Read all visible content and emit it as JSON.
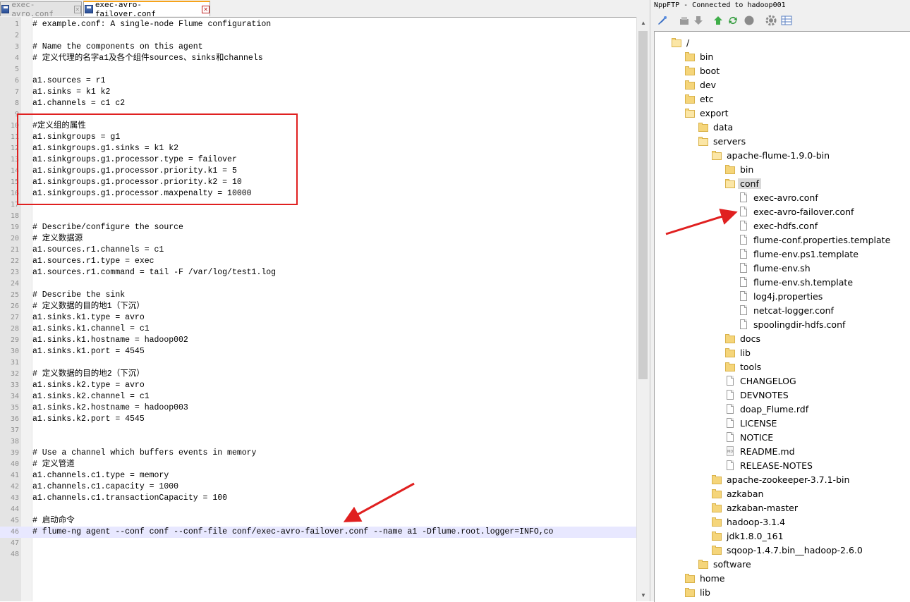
{
  "tabs": [
    {
      "label": "exec-avro.conf",
      "active": false
    },
    {
      "label": "exec-avro-failover.conf",
      "active": true
    }
  ],
  "editor": {
    "lines": [
      "# example.conf: A single-node Flume configuration",
      "",
      "# Name the components on this agent",
      "# 定义代理的名字a1及各个组件sources、sinks和channels",
      "",
      "a1.sources = r1",
      "a1.sinks = k1 k2",
      "a1.channels = c1 c2",
      "",
      "#定义组的属性",
      "a1.sinkgroups = g1",
      "a1.sinkgroups.g1.sinks = k1 k2",
      "a1.sinkgroups.g1.processor.type = failover",
      "a1.sinkgroups.g1.processor.priority.k1 = 5",
      "a1.sinkgroups.g1.processor.priority.k2 = 10",
      "a1.sinkgroups.g1.processor.maxpenalty = 10000",
      "",
      "",
      "# Describe/configure the source",
      "# 定义数据源",
      "a1.sources.r1.channels = c1",
      "a1.sources.r1.type = exec",
      "a1.sources.r1.command = tail -F /var/log/test1.log",
      "",
      "# Describe the sink",
      "# 定义数据的目的地1（下沉）",
      "a1.sinks.k1.type = avro",
      "a1.sinks.k1.channel = c1",
      "a1.sinks.k1.hostname = hadoop002",
      "a1.sinks.k1.port = 4545",
      "",
      "# 定义数据的目的地2（下沉）",
      "a1.sinks.k2.type = avro",
      "a1.sinks.k2.channel = c1",
      "a1.sinks.k2.hostname = hadoop003",
      "a1.sinks.k2.port = 4545",
      "",
      "",
      "# Use a channel which buffers events in memory",
      "# 定义管道",
      "a1.channels.c1.type = memory",
      "a1.channels.c1.capacity = 1000",
      "a1.channels.c1.transactionCapacity = 100",
      "",
      "# 启动命令",
      "# flume-ng agent --conf conf --conf-file conf/exec-avro-failover.conf --name a1 -Dflume.root.logger=INFO,co",
      "",
      ""
    ],
    "highlighted_line": 46
  },
  "ftp": {
    "title": "NppFTP - Connected to hadoop001",
    "toolbar_icons": [
      "connect-icon",
      "disconnect-icon",
      "download-icon",
      "upload-icon",
      "refresh-icon",
      "abort-icon",
      "settings-icon",
      "queue-icon"
    ],
    "tree": [
      {
        "label": "/",
        "depth": 0,
        "type": "folder",
        "open": true
      },
      {
        "label": "bin",
        "depth": 1,
        "type": "folder"
      },
      {
        "label": "boot",
        "depth": 1,
        "type": "folder"
      },
      {
        "label": "dev",
        "depth": 1,
        "type": "folder"
      },
      {
        "label": "etc",
        "depth": 1,
        "type": "folder"
      },
      {
        "label": "export",
        "depth": 1,
        "type": "folder",
        "open": true
      },
      {
        "label": "data",
        "depth": 2,
        "type": "folder"
      },
      {
        "label": "servers",
        "depth": 2,
        "type": "folder",
        "open": true
      },
      {
        "label": "apache-flume-1.9.0-bin",
        "depth": 3,
        "type": "folder",
        "open": true
      },
      {
        "label": "bin",
        "depth": 4,
        "type": "folder"
      },
      {
        "label": "conf",
        "depth": 4,
        "type": "folder",
        "open": true,
        "selected": true
      },
      {
        "label": "exec-avro.conf",
        "depth": 5,
        "type": "file"
      },
      {
        "label": "exec-avro-failover.conf",
        "depth": 5,
        "type": "file"
      },
      {
        "label": "exec-hdfs.conf",
        "depth": 5,
        "type": "file"
      },
      {
        "label": "flume-conf.properties.template",
        "depth": 5,
        "type": "file"
      },
      {
        "label": "flume-env.ps1.template",
        "depth": 5,
        "type": "file"
      },
      {
        "label": "flume-env.sh",
        "depth": 5,
        "type": "file"
      },
      {
        "label": "flume-env.sh.template",
        "depth": 5,
        "type": "file"
      },
      {
        "label": "log4j.properties",
        "depth": 5,
        "type": "file"
      },
      {
        "label": "netcat-logger.conf",
        "depth": 5,
        "type": "file"
      },
      {
        "label": "spoolingdir-hdfs.conf",
        "depth": 5,
        "type": "file"
      },
      {
        "label": "docs",
        "depth": 4,
        "type": "folder"
      },
      {
        "label": "lib",
        "depth": 4,
        "type": "folder"
      },
      {
        "label": "tools",
        "depth": 4,
        "type": "folder"
      },
      {
        "label": "CHANGELOG",
        "depth": 4,
        "type": "file"
      },
      {
        "label": "DEVNOTES",
        "depth": 4,
        "type": "file"
      },
      {
        "label": "doap_Flume.rdf",
        "depth": 4,
        "type": "file"
      },
      {
        "label": "LICENSE",
        "depth": 4,
        "type": "file"
      },
      {
        "label": "NOTICE",
        "depth": 4,
        "type": "file"
      },
      {
        "label": "README.md",
        "depth": 4,
        "type": "md"
      },
      {
        "label": "RELEASE-NOTES",
        "depth": 4,
        "type": "file"
      },
      {
        "label": "apache-zookeeper-3.7.1-bin",
        "depth": 3,
        "type": "folder"
      },
      {
        "label": "azkaban",
        "depth": 3,
        "type": "folder"
      },
      {
        "label": "azkaban-master",
        "depth": 3,
        "type": "folder"
      },
      {
        "label": "hadoop-3.1.4",
        "depth": 3,
        "type": "folder"
      },
      {
        "label": "jdk1.8.0_161",
        "depth": 3,
        "type": "folder"
      },
      {
        "label": "sqoop-1.4.7.bin__hadoop-2.6.0",
        "depth": 3,
        "type": "folder"
      },
      {
        "label": "software",
        "depth": 2,
        "type": "folder"
      },
      {
        "label": "home",
        "depth": 1,
        "type": "folder"
      },
      {
        "label": "lib",
        "depth": 1,
        "type": "folder"
      }
    ]
  },
  "colors": {
    "annotation_red": "#e02020",
    "highlight_line": "#e8e8ff",
    "folder": "#f5d57a"
  }
}
